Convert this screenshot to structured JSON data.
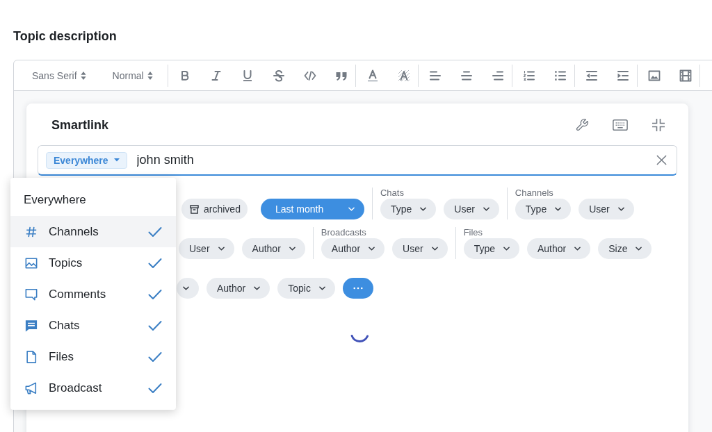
{
  "heading": "Topic description",
  "editor": {
    "toolbar": {
      "font": "Sans Serif",
      "size": "Normal"
    }
  },
  "smartlink": {
    "title": "Smartlink",
    "search": {
      "scope": "Everywhere",
      "value": "john smith",
      "scope_menu": {
        "title": "Everywhere",
        "items": [
          {
            "kind": "channel",
            "label": "Channels",
            "selected": true,
            "checked": true
          },
          {
            "kind": "topic",
            "label": "Topics",
            "selected": false,
            "checked": true
          },
          {
            "kind": "comment",
            "label": "Comments",
            "selected": false,
            "checked": true
          },
          {
            "kind": "chat",
            "label": "Chats",
            "selected": false,
            "checked": true
          },
          {
            "kind": "file",
            "label": "Files",
            "selected": false,
            "checked": true
          },
          {
            "kind": "broadcast",
            "label": "Broadcast",
            "selected": false,
            "checked": true
          }
        ]
      }
    },
    "filter_rows": [
      {
        "groups": [
          {
            "filters": [
              {
                "kind": "toggle",
                "label": "archived",
                "active": false
              },
              {
                "kind": "date",
                "label": "Last month",
                "active": true
              }
            ]
          },
          {
            "label": "Chats",
            "filters": [
              {
                "kind": "select",
                "label": "Type",
                "active": false
              },
              {
                "kind": "select",
                "label": "User",
                "active": false
              }
            ]
          },
          {
            "label": "Channels",
            "filters": [
              {
                "kind": "select",
                "label": "Type",
                "active": false
              },
              {
                "kind": "select",
                "label": "User",
                "active": false
              }
            ]
          }
        ]
      },
      {
        "groups": [
          {
            "filters": [
              {
                "kind": "select",
                "label": "User",
                "active": false
              },
              {
                "kind": "select",
                "label": "Author",
                "active": false
              }
            ]
          },
          {
            "label": "Broadcasts",
            "filters": [
              {
                "kind": "select",
                "label": "Author",
                "active": false
              },
              {
                "kind": "select",
                "label": "User",
                "active": false
              }
            ]
          },
          {
            "label": "Files",
            "filters": [
              {
                "kind": "select",
                "label": "Type",
                "active": false
              },
              {
                "kind": "select",
                "label": "Author",
                "active": false
              },
              {
                "kind": "select",
                "label": "Size",
                "active": false
              }
            ]
          }
        ]
      },
      {
        "groups": [
          {
            "filters": [
              {
                "kind": "select",
                "active": false
              },
              {
                "kind": "select",
                "label": "Author",
                "active": false
              },
              {
                "kind": "select",
                "label": "Topic",
                "active": false
              },
              {
                "kind": "more",
                "active": true
              }
            ]
          }
        ]
      }
    ],
    "loading": true
  }
}
